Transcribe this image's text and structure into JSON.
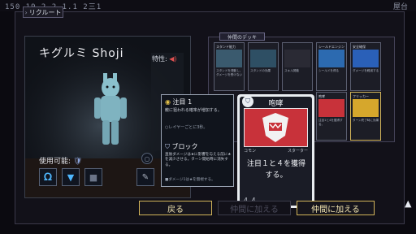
{
  "topbar": {
    "numbers": "150  19-2.2.1.1  2三1",
    "right_label": "屋台"
  },
  "tab_label": "リクルート",
  "character": {
    "name": "キグルミ Shoji",
    "trait_label": "特性:",
    "usable_label": "使用可能:"
  },
  "deck": {
    "title": "仲間のデッキ",
    "cards": [
      {
        "name": "スタンド能力",
        "desc": "スタンドを発動し、ダメージを受けない"
      },
      {
        "name": "",
        "desc": "スタンドの効果"
      },
      {
        "name": "",
        "desc": "スキル発動"
      },
      {
        "name": "シールドエンジン",
        "desc": "シールドを得る"
      },
      {
        "name": "安全確保",
        "desc": "ダメージを軽減する"
      },
      {
        "name": "",
        "desc": ""
      },
      {
        "name": "",
        "desc": ""
      },
      {
        "name": "",
        "desc": ""
      },
      {
        "name": "咆哮",
        "desc": "注目1と4を獲得する。"
      },
      {
        "name": "フリッカー",
        "desc": "ターン終了時に効果"
      }
    ]
  },
  "tooltip": {
    "sections": [
      {
        "title": "注目 1",
        "body": "敵に狙われる確率が増加する。",
        "extra": "○レイヤーごとに3秒。"
      },
      {
        "title": "ブロック",
        "body": "直後ダメージは★に影響を与える前に★を減少させる。ターン開始時に消失する。",
        "extra": "■ダメージ1は★を無視する。"
      }
    ]
  },
  "big_card": {
    "title": "咆哮",
    "left_tag": "コモン",
    "right_tag": "スターター",
    "text": "注目１と４を獲得する。",
    "cost": "4 4"
  },
  "buttons": {
    "back": "戻る",
    "add_disabled": "仲間に加える",
    "add": "仲間に加える"
  },
  "colors": {
    "accent_red": "#c8323a",
    "frame": "#3b394a",
    "gold": "#d2b45a"
  }
}
